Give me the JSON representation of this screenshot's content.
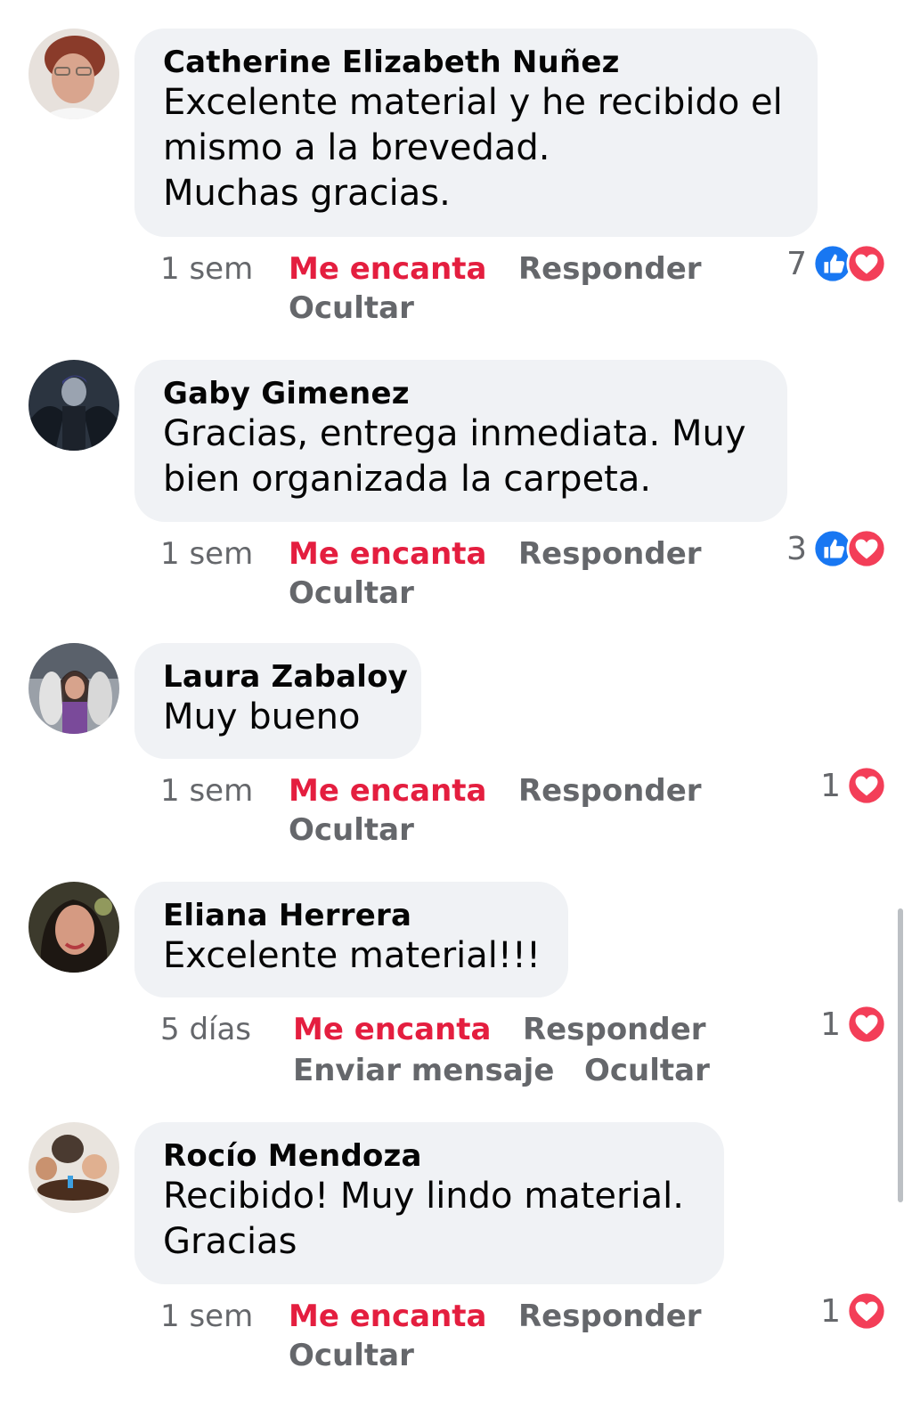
{
  "comments": [
    {
      "author": "Catherine Elizabeth Nuñez",
      "lines": [
        "Excelente material y he recibido el",
        "mismo a la brevedad.",
        "Muchas gracias."
      ],
      "time": "1 sem",
      "love_label": "Me encanta",
      "reply_label": "Responder",
      "hide_label": "Ocultar",
      "reaction_count": "7",
      "reactions": [
        "like-icon",
        "love-icon"
      ]
    },
    {
      "author": "Gaby Gimenez",
      "lines": [
        "Gracias, entrega inmediata. Muy",
        "bien organizada la carpeta."
      ],
      "time": "1 sem",
      "love_label": "Me encanta",
      "reply_label": "Responder",
      "hide_label": "Ocultar",
      "reaction_count": "3",
      "reactions": [
        "like-icon",
        "love-icon"
      ]
    },
    {
      "author": "Laura Zabaloy",
      "lines": [
        "Muy bueno"
      ],
      "time": "1 sem",
      "love_label": "Me encanta",
      "reply_label": "Responder",
      "hide_label": "Ocultar",
      "reaction_count": "1",
      "reactions": [
        "love-icon"
      ]
    },
    {
      "author": "Eliana Herrera",
      "lines": [
        "Excelente material!!!"
      ],
      "time": "5 días",
      "love_label": "Me encanta",
      "reply_label": "Responder",
      "message_label": "Enviar mensaje",
      "hide_label": "Ocultar",
      "reaction_count": "1",
      "reactions": [
        "love-icon"
      ]
    },
    {
      "author": "Rocío Mendoza",
      "lines": [
        "Recibido! Muy lindo material.",
        "Gracias"
      ],
      "time": "1 sem",
      "love_label": "Me encanta",
      "reply_label": "Responder",
      "hide_label": "Ocultar",
      "reaction_count": "1",
      "reactions": [
        "love-icon"
      ]
    }
  ],
  "colors": {
    "bubble": "#f0f2f5",
    "love": "#e41e3f",
    "like": "#1877f2",
    "meta": "#65676b"
  }
}
